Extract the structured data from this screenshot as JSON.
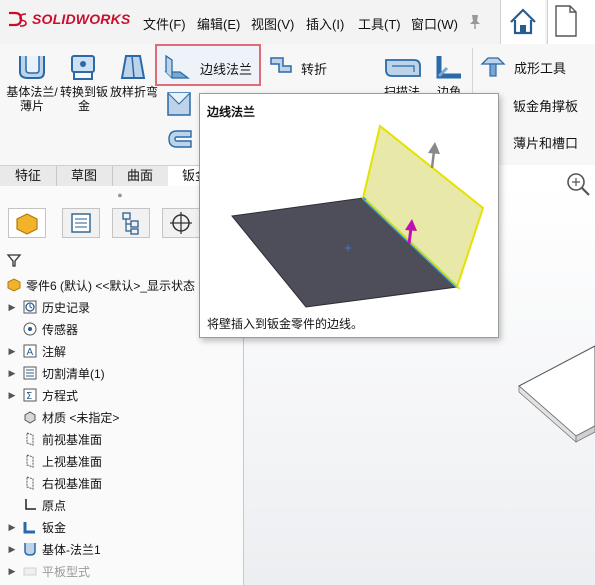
{
  "app": {
    "brand": "SOLIDWORKS"
  },
  "menu": {
    "items": [
      "文件(F)",
      "编辑(E)",
      "视图(V)",
      "插入(I)",
      "工具(T)",
      "窗口(W)"
    ]
  },
  "ribbon": {
    "base_flange": "基体法兰/薄片",
    "convert_to_sheetmetal": "转换到钣金",
    "lofted_bend": "放样折弯",
    "edge_flange": "边线法兰",
    "jog": "转折",
    "swept_flange": "扫描法",
    "corner": "边角",
    "forming_tool": "成形工具",
    "sheetmetal_gusset": "钣金角撑板",
    "tab_and_slot": "薄片和槽口"
  },
  "tabs": [
    "特征",
    "草图",
    "曲面",
    "钣金"
  ],
  "tooltip": {
    "title": "边线法兰",
    "description": "将壁插入到钣金零件的边线。"
  },
  "tree": {
    "root": "零件6 (默认) <<默认>_显示状态",
    "items": [
      {
        "label": "历史记录",
        "icon": "history-icon",
        "expand": true
      },
      {
        "label": "传感器",
        "icon": "sensor-icon",
        "expand": false
      },
      {
        "label": "注解",
        "icon": "annotation-icon",
        "expand": true
      },
      {
        "label": "切割清单(1)",
        "icon": "cut-list-icon",
        "expand": true
      },
      {
        "label": "方程式",
        "icon": "equation-icon",
        "expand": true
      },
      {
        "label": "材质 <未指定>",
        "icon": "material-icon",
        "expand": false
      },
      {
        "label": "前视基准面",
        "icon": "plane-icon",
        "expand": false
      },
      {
        "label": "上视基准面",
        "icon": "plane-icon",
        "expand": false
      },
      {
        "label": "右视基准面",
        "icon": "plane-icon",
        "expand": false
      },
      {
        "label": "原点",
        "icon": "origin-icon",
        "expand": false
      },
      {
        "label": "钣金",
        "icon": "sheetmetal-icon",
        "expand": true
      },
      {
        "label": "基体-法兰1",
        "icon": "base-flange-icon",
        "expand": true
      },
      {
        "label": "平板型式",
        "icon": "flat-pattern-icon",
        "expand": true,
        "dim": true
      }
    ]
  },
  "colors": {
    "brand_red": "#c8102e",
    "highlight_border": "#e06a78",
    "flange_yellow": "#e8e8a8"
  }
}
